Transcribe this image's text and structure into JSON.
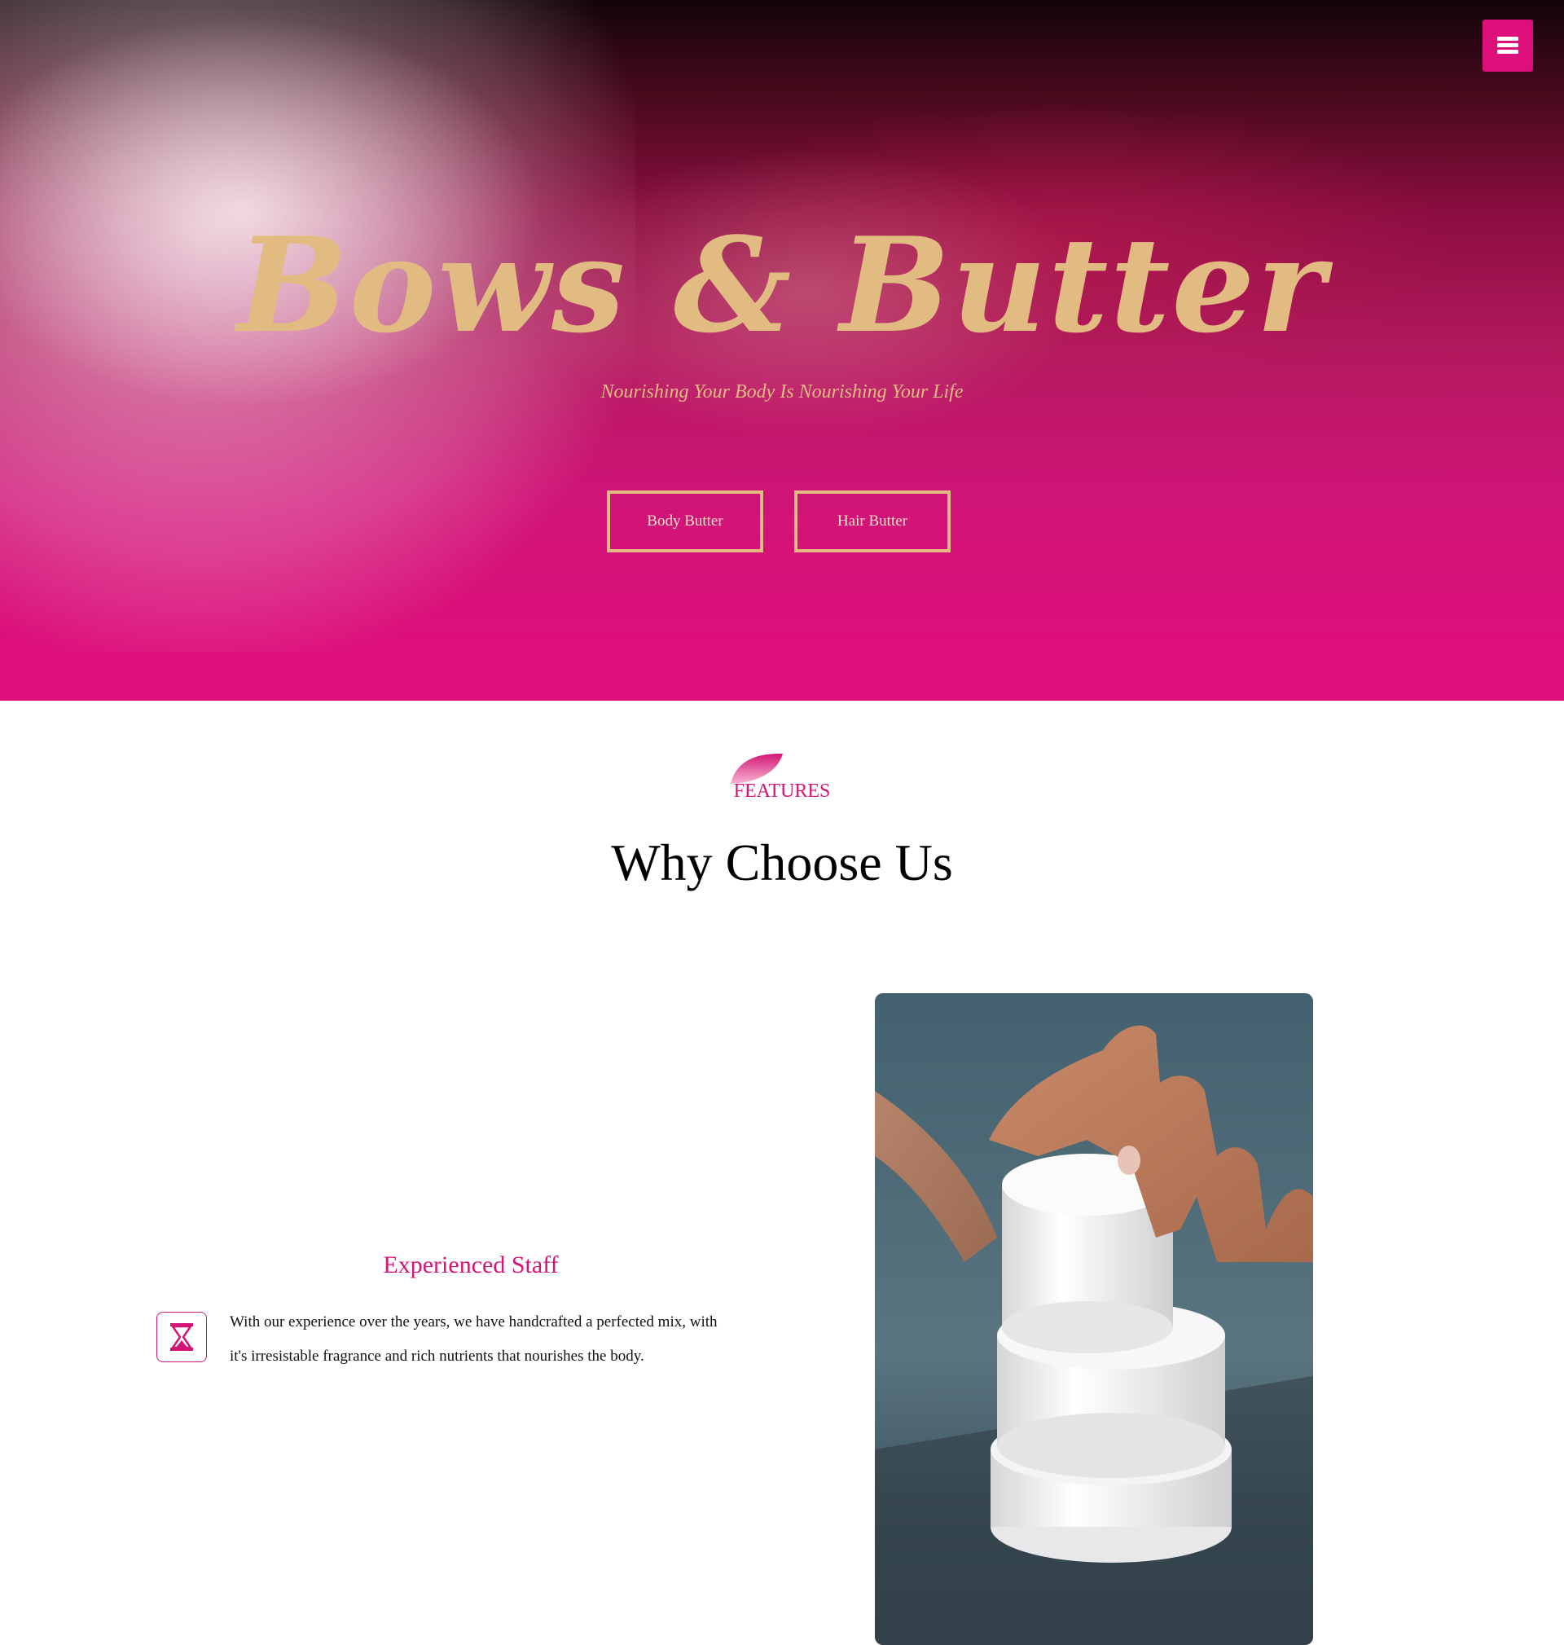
{
  "hero": {
    "title": "Bows & Butter",
    "subtitle": "Nourishing Your Body Is Nourishing Your Life",
    "buttons": [
      {
        "label": "Body Butter"
      },
      {
        "label": "Hair Butter"
      }
    ]
  },
  "menu": {
    "icon": "hamburger-icon"
  },
  "features": {
    "label": "FEATURES",
    "title": "Why Choose Us",
    "items": [
      {
        "title": "Experienced Staff",
        "icon": "hourglass-icon",
        "text_line1": "With our experience over the years, we have handcrafted a perfected mix, with",
        "text_line2": "it's irresistable fragrance and rich nutrients that nourishes the body."
      }
    ]
  },
  "colors": {
    "accent": "#dd0f7b",
    "gold": "#e2bb83",
    "feature_pink": "#d41476"
  }
}
